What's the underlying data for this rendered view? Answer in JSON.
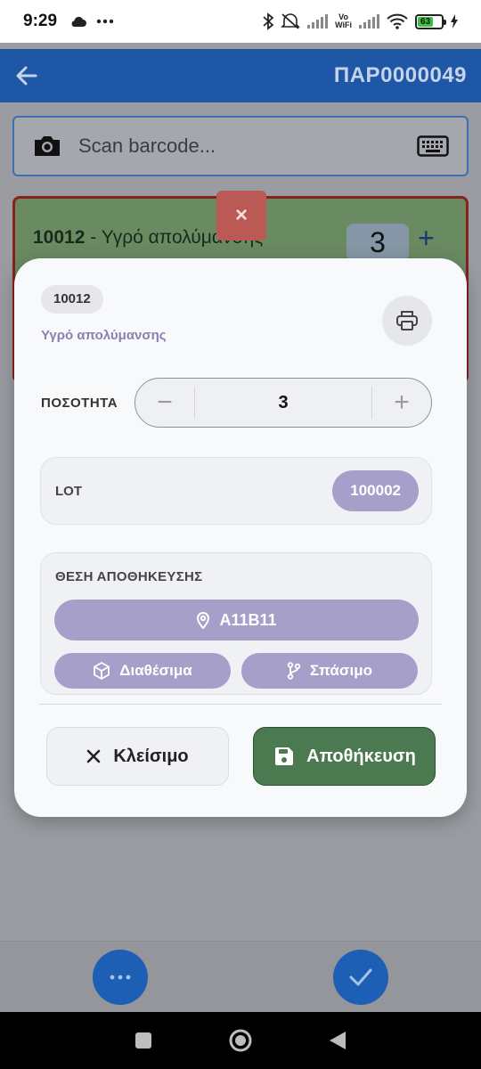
{
  "status_bar": {
    "time": "9:29",
    "vowifi_top": "Vo",
    "vowifi_bottom": "WiFi",
    "battery": "63"
  },
  "app_bar": {
    "title": "ΠΑΡ0000049"
  },
  "scan": {
    "placeholder": "Scan barcode..."
  },
  "background_item": {
    "code": "10012",
    "separator": " - ",
    "name": "Υγρό απολύμανσης",
    "quantity": "3",
    "plus": "+",
    "delete": "×"
  },
  "modal": {
    "code": "10012",
    "product_name": "Υγρό απολύμανσης",
    "quantity_label": "ΠΟΣΟΤΗΤΑ",
    "quantity_value": "3",
    "minus": "−",
    "plus": "+",
    "lot_label": "LOT",
    "lot_value": "100002",
    "location_label": "ΘΕΣΗ ΑΠΟΘΗΚΕΥΣΗΣ",
    "location_value": "A11B11",
    "available_label": "Διαθέσιμα",
    "split_label": "Σπάσιμο",
    "close_label": "Κλείσιμο",
    "save_label": "Αποθήκευση"
  },
  "colors": {
    "app_bar": "#1d57a6",
    "accent_purple": "#a59fc9",
    "save_green": "#4b7a50",
    "fab_blue": "#1d5fb5"
  }
}
